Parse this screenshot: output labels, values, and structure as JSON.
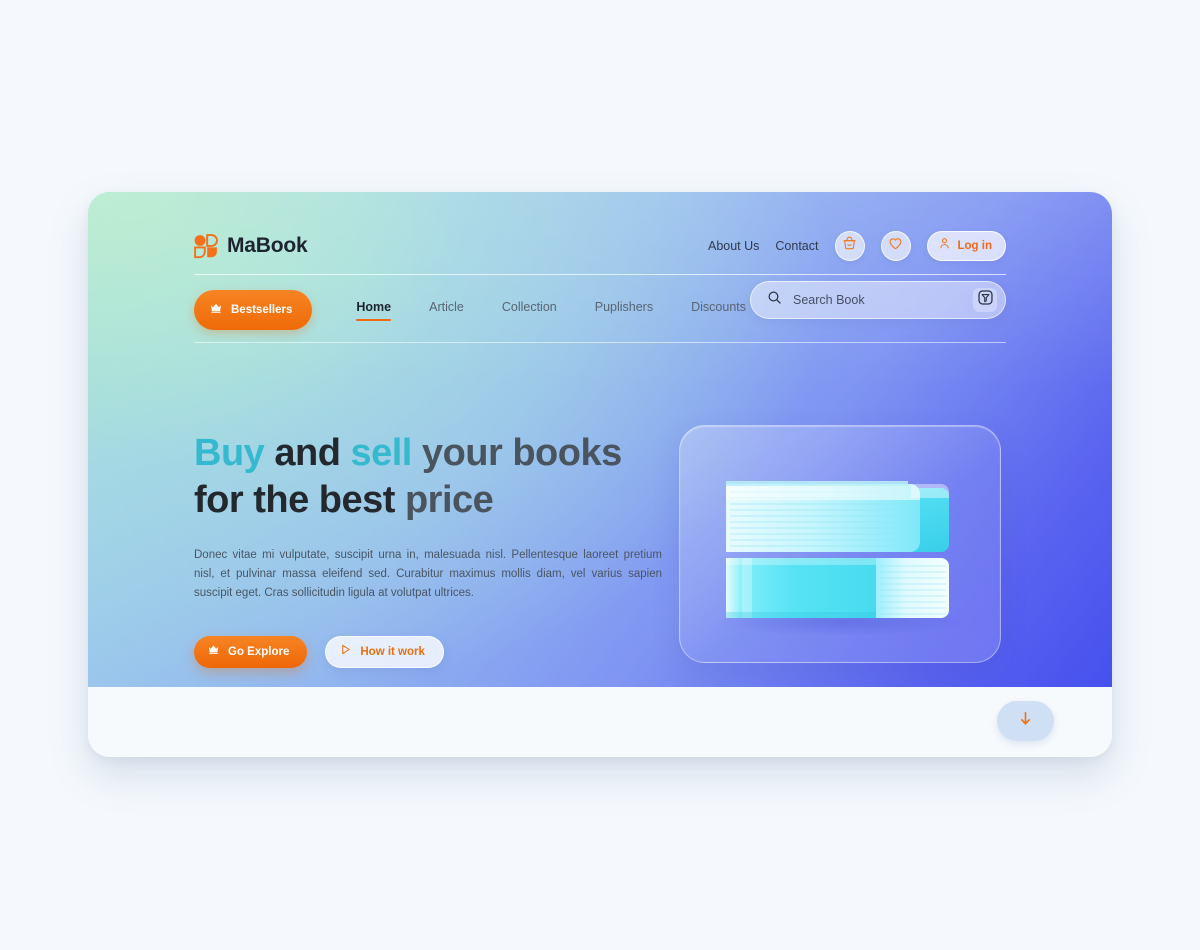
{
  "brand": {
    "name": "MaBook",
    "logo_icon": "mabook-logo-icon"
  },
  "header": {
    "links": [
      {
        "label": "About Us",
        "name": "about-us"
      },
      {
        "label": "Contact",
        "name": "contact"
      }
    ],
    "cart_icon": "basket-icon",
    "wishlist_icon": "heart-icon",
    "login": {
      "label": "Log in",
      "icon": "user-icon"
    }
  },
  "subnav": {
    "bestsellers": {
      "label": "Bestsellers",
      "icon": "crown-icon"
    },
    "items": [
      {
        "label": "Home",
        "active": true
      },
      {
        "label": "Article",
        "active": false
      },
      {
        "label": "Collection",
        "active": false
      },
      {
        "label": "Puplishers",
        "active": false
      },
      {
        "label": "Discounts",
        "active": false
      }
    ]
  },
  "search": {
    "placeholder": "Search Book",
    "value": "",
    "search_icon": "search-icon",
    "filter_icon": "filter-icon"
  },
  "hero": {
    "headline": {
      "word1": "Buy",
      "word2": " and ",
      "word3": "sell",
      "word4": " your books",
      "line2_a": "for the best ",
      "line2_b": "price"
    },
    "paragraph": "Donec vitae mi vulputate, suscipit urna in, malesuada nisl. Pellentesque laoreet pretium nisl, et pulvinar massa eleifend sed. Curabitur maximus mollis diam, vel varius sapien suscipit eget. Cras sollicitudin ligula at volutpat ultrices.",
    "primary_cta": {
      "label": "Go Explore",
      "icon": "crown-icon"
    },
    "secondary_cta": {
      "label": "How it work",
      "icon": "play-icon"
    },
    "illustration": "stacked-books-illustration"
  },
  "footer": {
    "scroll_down_icon": "arrow-down-icon"
  },
  "colors": {
    "accent_orange": "#ee6707",
    "accent_cyan": "#35b9cf",
    "hero_start": "#a7e3d2",
    "hero_end": "#4650ee",
    "page_background": "#f5f9fd",
    "footer_background": "#f7fafd",
    "book_cyan": "#46e4f5"
  }
}
